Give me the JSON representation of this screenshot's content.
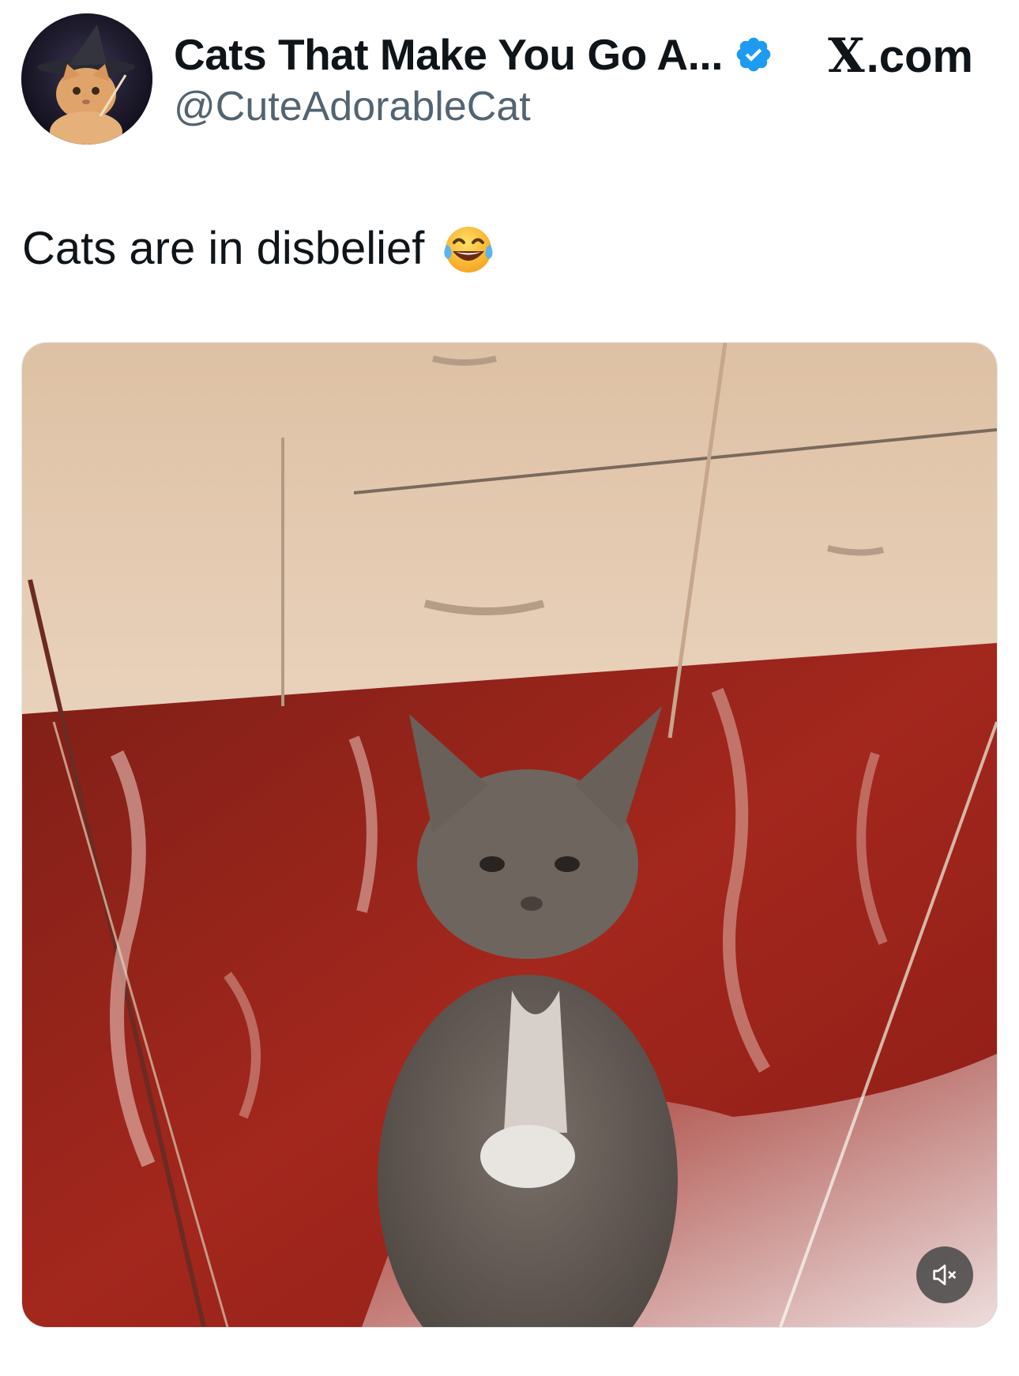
{
  "header": {
    "display_name": "Cats That Make You Go A...",
    "handle": "@CuteAdorableCat",
    "site_x": "X",
    "site_suffix": ".com",
    "verified_icon": "verified-badge-icon",
    "verified_color": "#1d9bf0"
  },
  "tweet": {
    "text": "Cats are in disbelief",
    "emoji": "face-with-tears-of-joy"
  },
  "media": {
    "type": "video",
    "mute_icon": "muted-speaker-icon",
    "colors": {
      "floor_red": "#9a2a20",
      "cabinet_beige": "#d9b89a",
      "cat_gray": "#6b625c"
    }
  }
}
